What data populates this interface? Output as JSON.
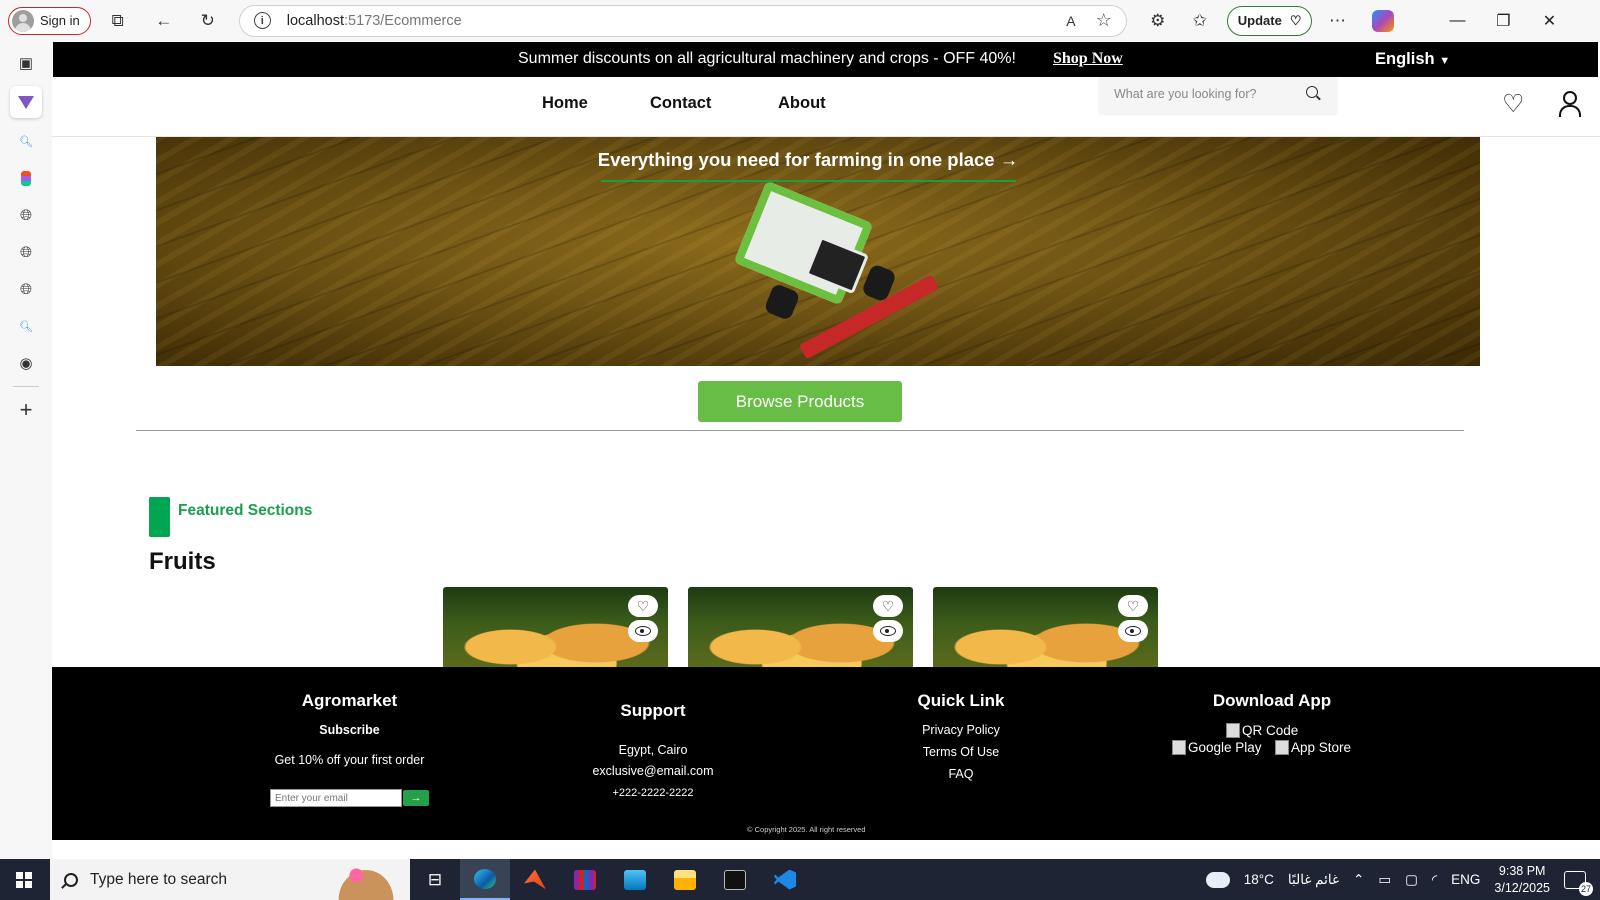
{
  "browser": {
    "signin_label": "Sign in",
    "url_host": "localhost",
    "url_path": ":5173/Ecommerce",
    "read_aloud": "A",
    "update_label": "Update"
  },
  "page": {
    "promo_text": "Summer discounts on all agricultural machinery and crops - OFF 40%!",
    "shop_now": "Shop Now",
    "language": "English",
    "nav": [
      "Home",
      "Contact",
      "About"
    ],
    "search_placeholder": "What are you looking for?",
    "hero_title": "Everything you need for farming in one place →",
    "browse_button": "Browse Products",
    "featured_label": "Featured Sections",
    "section_title": "Fruits",
    "product_count": 3
  },
  "footer": {
    "brand": "Agromarket",
    "subscribe": "Subscribe",
    "offer": "Get 10% off your first order",
    "email_placeholder": "Enter your email",
    "support": {
      "title": "Support",
      "address": "Egypt, Cairo",
      "email": "exclusive@email.com",
      "phone": "+222-2222-2222"
    },
    "quick_link": {
      "title": "Quick Link",
      "items": [
        "Privacy Policy",
        "Terms Of Use",
        "FAQ"
      ]
    },
    "download": {
      "title": "Download App",
      "qr_alt": "QR Code",
      "google_alt": "Google Play",
      "apple_alt": "App Store"
    },
    "copyright": "© Copyright 2025. All right reserved"
  },
  "taskbar": {
    "search_placeholder": "Type here to search",
    "temperature": "18°C",
    "weather_text": "غائم غالبًا",
    "language": "ENG",
    "time": "9:38 PM",
    "date": "3/12/2025",
    "notifications": "27"
  },
  "colors": {
    "accent_green": "#67bd45",
    "featured_green": "#1c9f4c",
    "topbar": "#000000",
    "footer": "#000000"
  }
}
